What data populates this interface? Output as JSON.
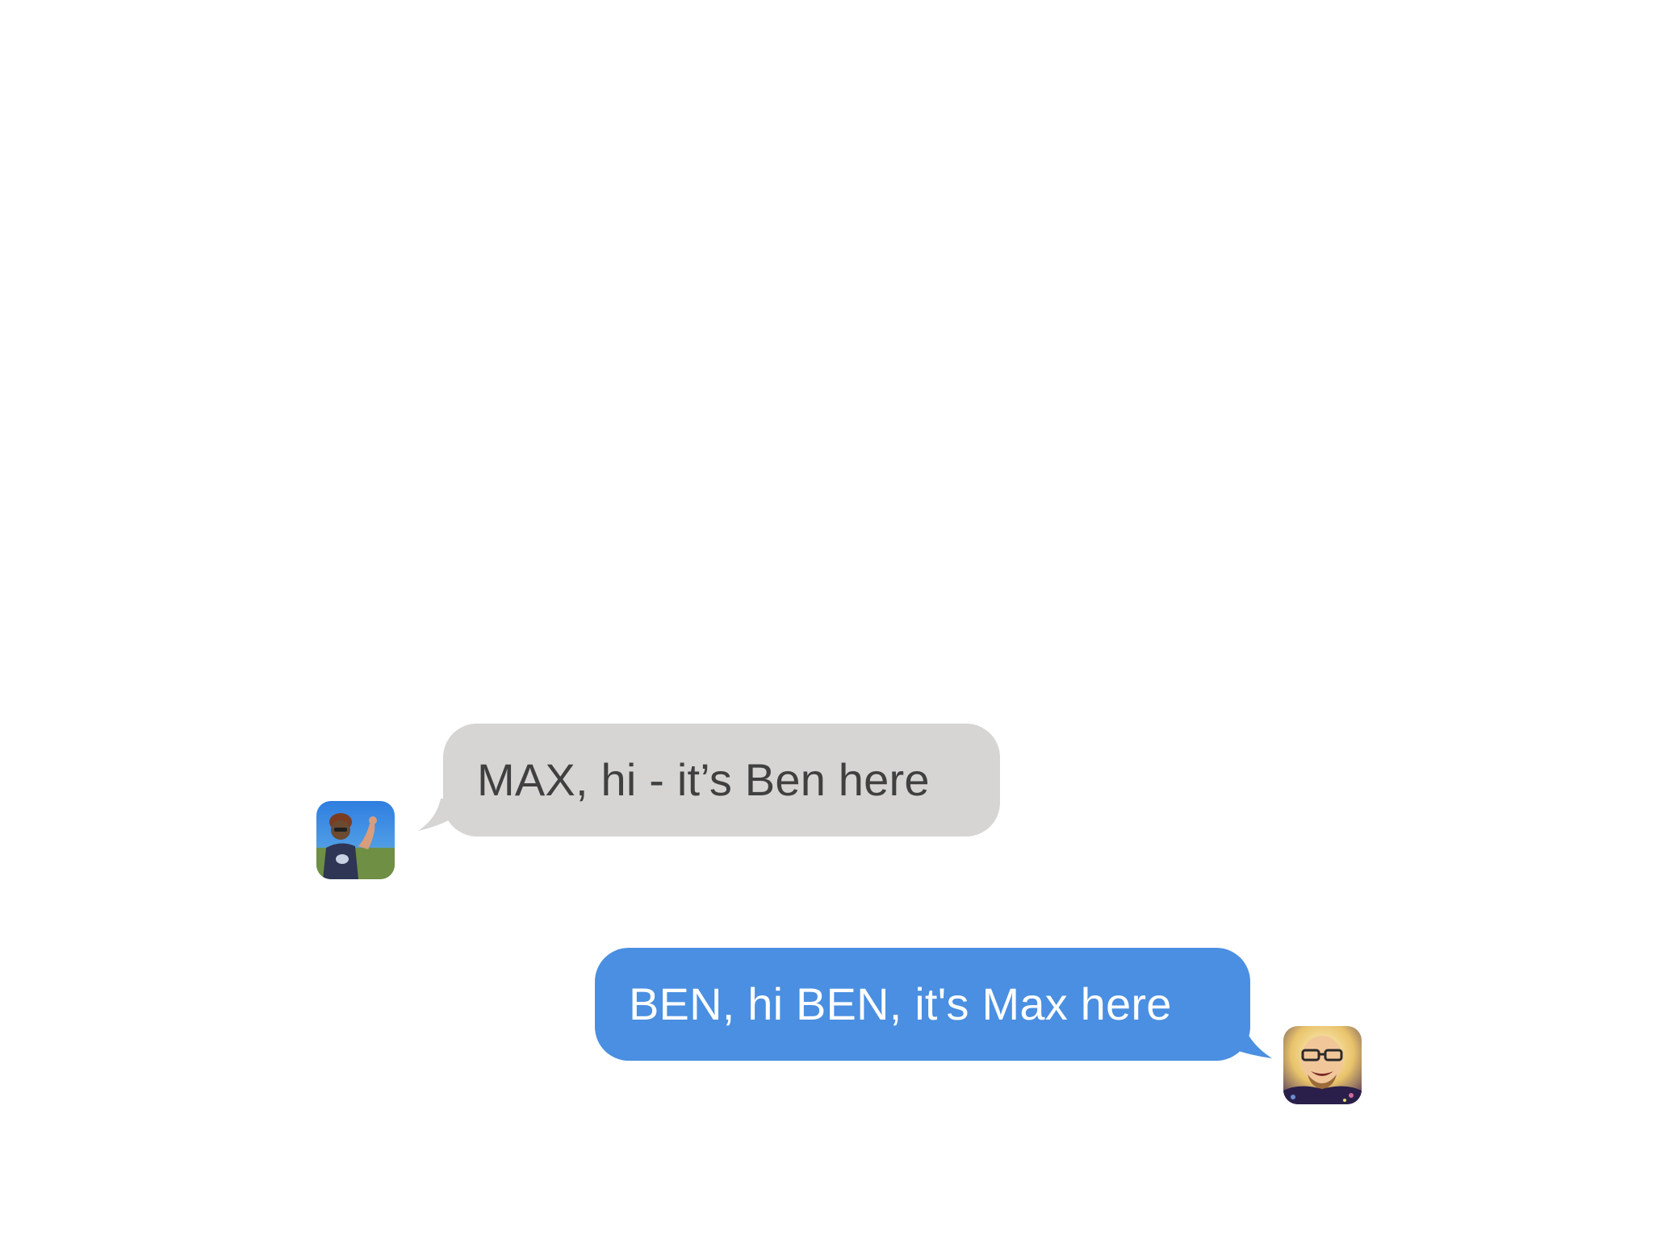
{
  "conversation": {
    "messages": [
      {
        "sender": "Ben",
        "direction": "incoming",
        "text": "MAX, hi - it’s Ben here",
        "bubble_color": "#d6d5d4",
        "text_color": "#404040",
        "avatar_icon": "ben-avatar-photo"
      },
      {
        "sender": "Max",
        "direction": "outgoing",
        "text": "BEN, hi BEN, it's Max here",
        "bubble_color": "#4a8fe1",
        "text_color": "#ffffff",
        "avatar_icon": "max-avatar-photo"
      }
    ]
  },
  "colors": {
    "background": "#ffffff",
    "incoming_bubble": "#d6d5d4",
    "outgoing_bubble": "#4a8fe1"
  }
}
